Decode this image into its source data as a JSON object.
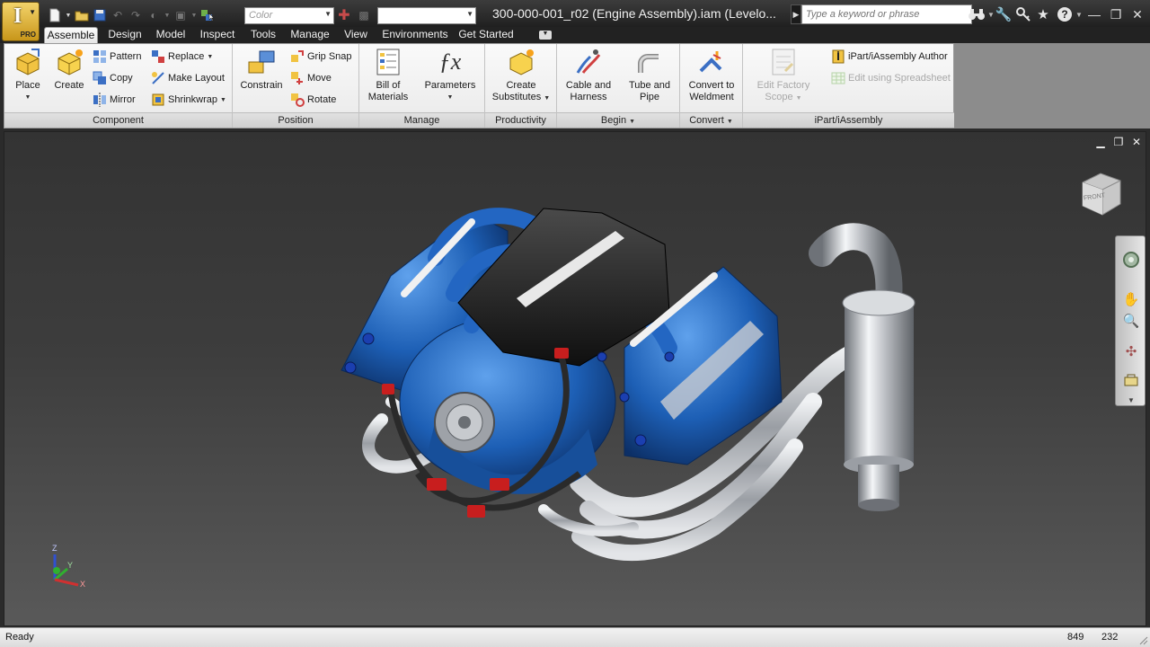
{
  "titlebar": {
    "window_title": "300-000-001_r02 (Engine Assembly).iam (Levelo...",
    "app_button_badge": "PRO",
    "color_combo_placeholder": "Color",
    "second_combo_value": "",
    "search_placeholder": "Type a keyword or phrase"
  },
  "tabs": [
    {
      "label": "Assemble",
      "active": true
    },
    {
      "label": "Design"
    },
    {
      "label": "Model"
    },
    {
      "label": "Inspect"
    },
    {
      "label": "Tools"
    },
    {
      "label": "Manage"
    },
    {
      "label": "View"
    },
    {
      "label": "Environments"
    },
    {
      "label": "Get Started"
    }
  ],
  "ribbon": {
    "component": {
      "title": "Component",
      "place": "Place",
      "create": "Create",
      "pattern": "Pattern",
      "copy": "Copy",
      "mirror": "Mirror",
      "replace": "Replace",
      "make_layout": "Make Layout",
      "shrinkwrap": "Shrinkwrap"
    },
    "position": {
      "title": "Position",
      "constrain": "Constrain",
      "grip_snap": "Grip Snap",
      "move": "Move",
      "rotate": "Rotate"
    },
    "manage": {
      "title": "Manage",
      "bom_line1": "Bill of",
      "bom_line2": "Materials",
      "parameters": "Parameters"
    },
    "productivity": {
      "title": "Productivity",
      "line1": "Create",
      "line2": "Substitutes"
    },
    "begin": {
      "title": "Begin",
      "cable_line1": "Cable and",
      "cable_line2": "Harness",
      "tube_line1": "Tube and",
      "tube_line2": "Pipe"
    },
    "convert": {
      "title": "Convert",
      "line1": "Convert to",
      "line2": "Weldment"
    },
    "ipart": {
      "title": "iPart/iAssembly",
      "factory_line1": "Edit Factory",
      "factory_line2": "Scope",
      "author": "iPart/iAssembly Author",
      "spreadsheet": "Edit using Spreadsheet"
    }
  },
  "viewport": {
    "viewcube_face": "FRONT",
    "triad_x": "X",
    "triad_y": "Y",
    "triad_z": "Z"
  },
  "status": {
    "text": "Ready",
    "num1": "849",
    "num2": "232"
  },
  "colors": {
    "engine_blue": "#1d5fb5",
    "chrome": "#cfd2d6",
    "viewport_top": "#333333",
    "viewport_bottom": "#595959",
    "fitting_red": "#c81e1e"
  },
  "icons": [
    "app-menu-icon",
    "new-icon",
    "open-icon",
    "save-icon",
    "undo-icon",
    "redo-icon",
    "select-icon",
    "search-icon",
    "binoculars-icon",
    "wrench-icon",
    "star-icon",
    "help-icon",
    "minimize-icon",
    "maximize-icon",
    "close-icon",
    "steering-wheel-icon",
    "pan-icon",
    "zoom-icon",
    "orbit-icon",
    "look-at-icon"
  ]
}
